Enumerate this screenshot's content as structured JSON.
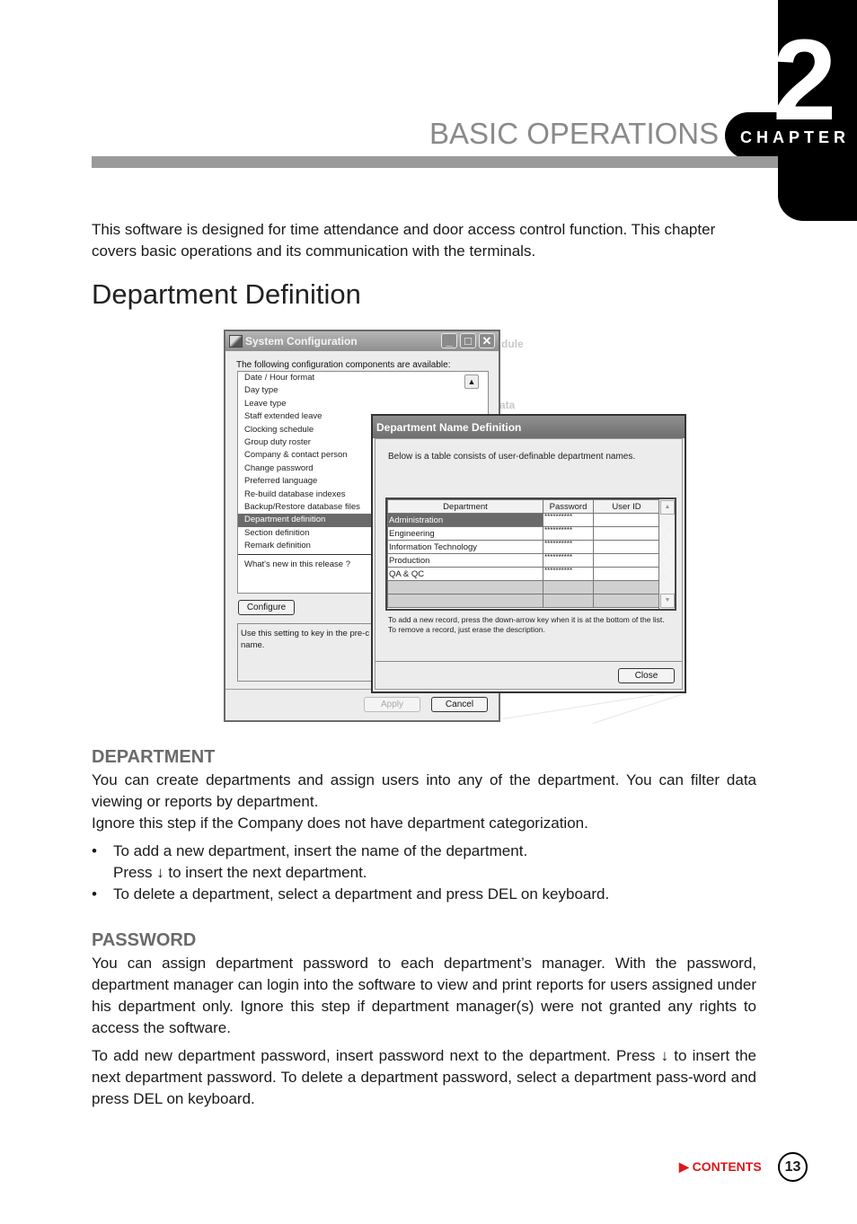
{
  "chapter": {
    "label": "CHAPTER",
    "number": "2",
    "heading": "BASIC OPERATIONS"
  },
  "intro": "This software is designed for time attendance and door access control function.  This chapter covers basic operations and its communication with the terminals.",
  "section_title": "Department Definition",
  "screenshot": {
    "ghost_labels": [
      "dule",
      "ata"
    ],
    "system_configuration": {
      "title": "System Configuration",
      "window_buttons": {
        "minimize": "_",
        "maximize": "□",
        "close": "✕"
      },
      "available_label": "The following configuration components are available:",
      "items": [
        "Date / Hour format",
        "Day type",
        "Leave type",
        "Staff extended leave",
        "Clocking schedule",
        "Group duty roster",
        "Company & contact person",
        "Change password",
        "Preferred language",
        "Re-build database indexes",
        "Backup/Restore database files",
        "Department definition",
        "Section definition",
        "Remark definition"
      ],
      "selected_item": "Department definition",
      "whats_new": "What's new in this release ?",
      "configure_button": "Configure",
      "description": "Use this setting to key in the pre-c... name.",
      "description_line1": "Use this setting to key in the pre-c",
      "description_line2": "name.",
      "apply_button": "Apply",
      "cancel_button": "Cancel"
    },
    "department_name_definition": {
      "title": "Department Name Definition",
      "description": "Below is a table consists of user-definable department names.",
      "columns": [
        "Department",
        "Password",
        "User ID"
      ],
      "rows": [
        {
          "department": "Administration",
          "password": "**********",
          "user_id": ""
        },
        {
          "department": "Engineering",
          "password": "**********",
          "user_id": ""
        },
        {
          "department": "Information Technology",
          "password": "**********",
          "user_id": ""
        },
        {
          "department": "Production",
          "password": "**********",
          "user_id": ""
        },
        {
          "department": "QA & QC",
          "password": "**********",
          "user_id": ""
        }
      ],
      "selected_row": "Administration",
      "hint_line1": "To add a new record, press the down-arrow key when it is at the bottom of the list.",
      "hint_line2": "To remove a record, just erase the description.",
      "close_button": "Close"
    }
  },
  "department_section": {
    "heading": "DEPARTMENT",
    "para1": "You can create departments and assign users into any of the department. You can filter data viewing or reports by department.",
    "para2": "Ignore this step if the Company does not have department categorization.",
    "bullets": [
      {
        "line1": "To add a new department, insert the name of the department.",
        "line2": "Press ↓  to insert the next department."
      },
      {
        "line1": "To delete a department, select a department and press DEL on keyboard.",
        "line2": ""
      }
    ],
    "bullet_char": "•"
  },
  "password_section": {
    "heading": "PASSWORD",
    "para1": "You can assign department password to each department’s manager.  With the password, department manager can login into the software to view and print reports for users assigned under his department only. Ignore this step if department manager(s) were not granted any rights to access the software.",
    "para2": "To add new department password, insert password next to the department. Press ↓  to insert the next department password. To delete a department password, select a department pass-word and press DEL on keyboard."
  },
  "footer": {
    "contents_link": "▶ CONTENTS",
    "page_number": "13"
  }
}
